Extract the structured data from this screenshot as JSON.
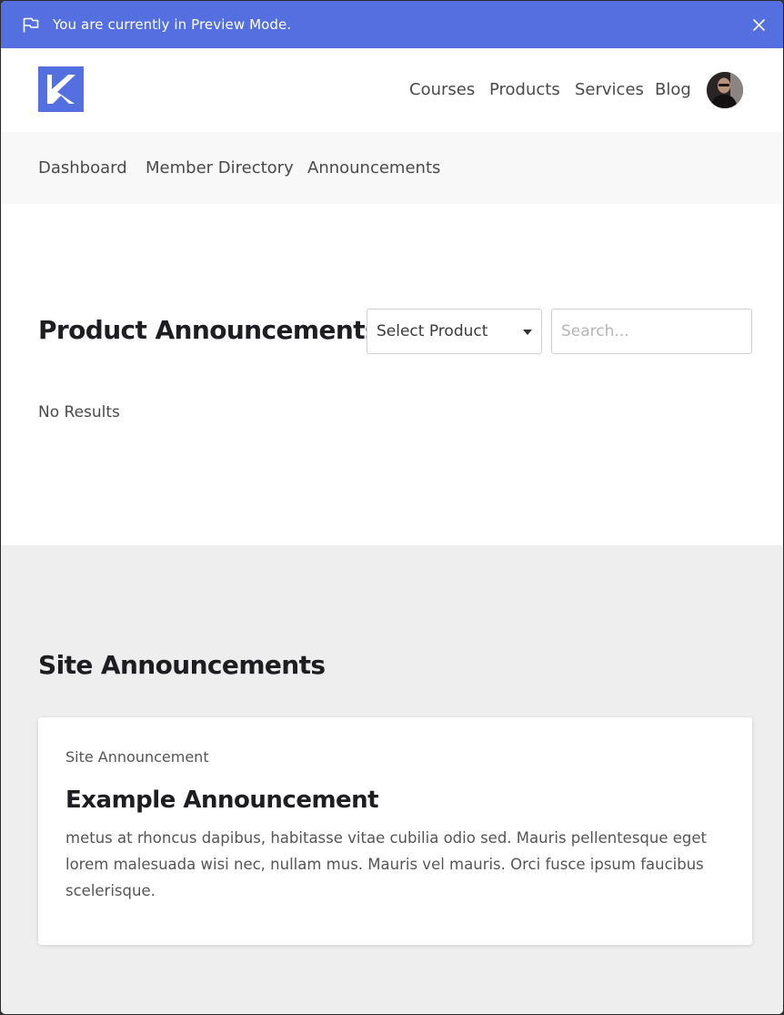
{
  "preview_bar": {
    "message": "You are currently in Preview Mode.",
    "flag_icon": "flag-icon",
    "close_icon": "close-icon",
    "color": "#5470e0"
  },
  "header": {
    "logo": "kajabi-logo",
    "nav": [
      "Courses",
      "Products",
      "Services",
      "Blog"
    ],
    "avatar": "user-avatar"
  },
  "subnav": {
    "items": [
      "Dashboard",
      "Member Directory",
      "Announcements"
    ]
  },
  "product_announcements": {
    "title": "Product Announcements",
    "select_value": "Select Product",
    "search_placeholder": "Search...",
    "empty_text": "No Results"
  },
  "site_announcements": {
    "title": "Site Announcements",
    "card": {
      "kicker": "Site Announcement",
      "title": "Example Announcement",
      "body": "metus at rhoncus dapibus, habitasse vitae cubilia odio sed. Mauris pellentesque eget lorem malesuada wisi nec, nullam mus. Mauris vel mauris. Orci fusce ipsum faucibus scelerisque."
    }
  },
  "colors": {
    "accent": "#5470e0",
    "heading": "#1d1d22",
    "site_bg": "#eeeeee",
    "subnav_bg": "#f8f8f8"
  }
}
